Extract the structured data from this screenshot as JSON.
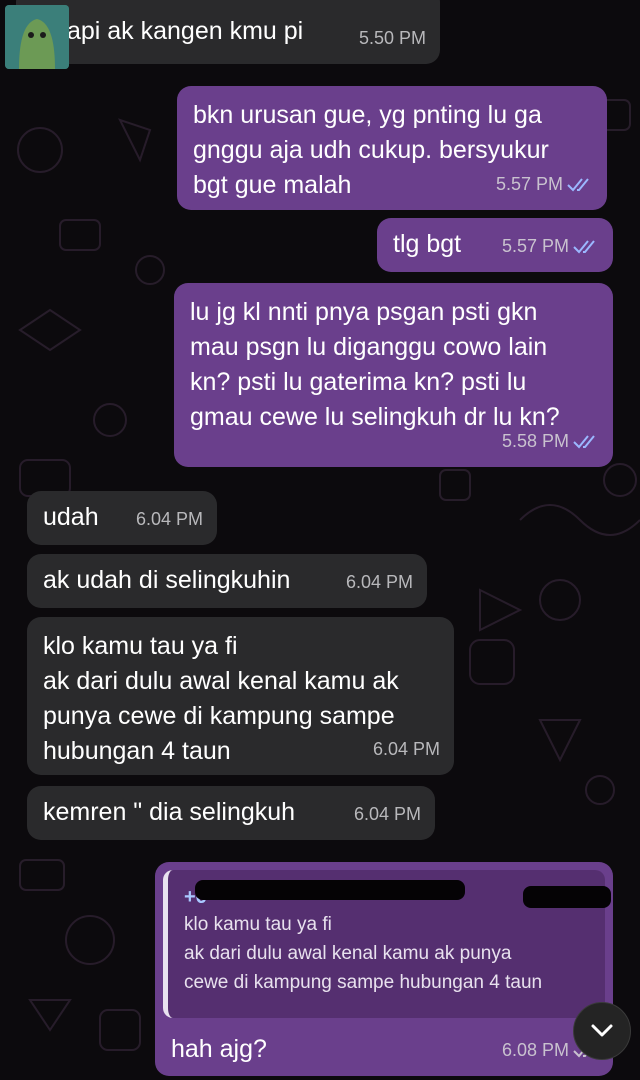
{
  "messages": [
    {
      "id": "m1",
      "dir": "in",
      "text": "tapi ak kangen kmu pi",
      "time": "5.50 PM"
    },
    {
      "id": "m2",
      "dir": "out",
      "text": "bkn urusan gue, yg pnting lu ga\ngnggu aja udh cukup. bersyukur\nbgt gue malah",
      "time": "5.57 PM"
    },
    {
      "id": "m3",
      "dir": "out",
      "text": "tlg bgt",
      "time": "5.57 PM"
    },
    {
      "id": "m4",
      "dir": "out",
      "text": "lu jg kl nnti pnya psgan psti gkn\nmau psgn lu diganggu cowo lain\nkn? psti lu gaterima kn? psti lu\ngmau cewe lu selingkuh dr lu kn?",
      "time": "5.58 PM"
    },
    {
      "id": "m5",
      "dir": "in",
      "text": "udah",
      "time": "6.04 PM"
    },
    {
      "id": "m6",
      "dir": "in",
      "text": "ak udah di selingkuhin",
      "time": "6.04 PM"
    },
    {
      "id": "m7",
      "dir": "in",
      "text": "klo kamu tau ya fi\nak dari dulu awal kenal kamu ak\npunya cewe di kampung sampe\nhubungan 4 taun",
      "time": "6.04 PM"
    },
    {
      "id": "m8",
      "dir": "in",
      "text": "kemren \" dia selingkuh",
      "time": "6.04 PM"
    },
    {
      "id": "m9",
      "dir": "out",
      "text": "hah ajg?",
      "time": "6.08 PM",
      "reply": {
        "sender": "+6",
        "text": "klo kamu tau ya fi\nak dari dulu awal kenal kamu ak punya\ncewe di kampung sampe hubungan 4 taun"
      }
    }
  ],
  "colors": {
    "incoming": "#2a2a2c",
    "outgoing": "#6a3f8c",
    "read_ticks": "#9bb8ff",
    "background": "#0c0a0d"
  },
  "icons": {
    "read_receipt": "double-check-icon",
    "scroll_down": "chevron-down-icon",
    "avatar": "contact-avatar"
  }
}
